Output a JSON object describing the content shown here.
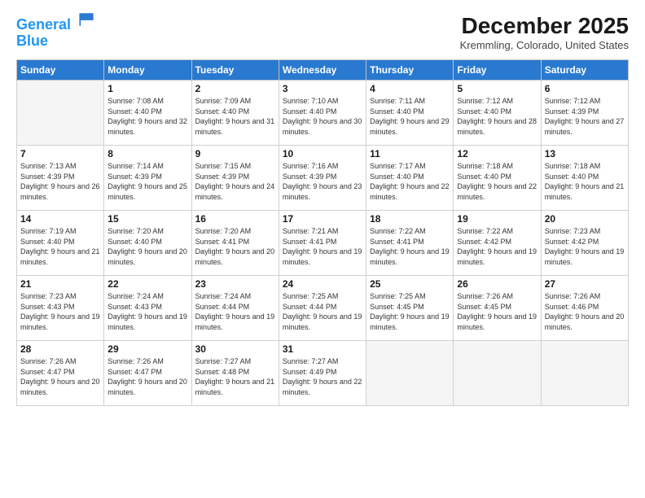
{
  "header": {
    "logo_line1": "General",
    "logo_line2": "Blue",
    "month_title": "December 2025",
    "location": "Kremmling, Colorado, United States"
  },
  "weekdays": [
    "Sunday",
    "Monday",
    "Tuesday",
    "Wednesday",
    "Thursday",
    "Friday",
    "Saturday"
  ],
  "weeks": [
    [
      {
        "day": "",
        "sunrise": "",
        "sunset": "",
        "daylight": ""
      },
      {
        "day": "1",
        "sunrise": "Sunrise: 7:08 AM",
        "sunset": "Sunset: 4:40 PM",
        "daylight": "Daylight: 9 hours and 32 minutes."
      },
      {
        "day": "2",
        "sunrise": "Sunrise: 7:09 AM",
        "sunset": "Sunset: 4:40 PM",
        "daylight": "Daylight: 9 hours and 31 minutes."
      },
      {
        "day": "3",
        "sunrise": "Sunrise: 7:10 AM",
        "sunset": "Sunset: 4:40 PM",
        "daylight": "Daylight: 9 hours and 30 minutes."
      },
      {
        "day": "4",
        "sunrise": "Sunrise: 7:11 AM",
        "sunset": "Sunset: 4:40 PM",
        "daylight": "Daylight: 9 hours and 29 minutes."
      },
      {
        "day": "5",
        "sunrise": "Sunrise: 7:12 AM",
        "sunset": "Sunset: 4:40 PM",
        "daylight": "Daylight: 9 hours and 28 minutes."
      },
      {
        "day": "6",
        "sunrise": "Sunrise: 7:12 AM",
        "sunset": "Sunset: 4:39 PM",
        "daylight": "Daylight: 9 hours and 27 minutes."
      }
    ],
    [
      {
        "day": "7",
        "sunrise": "Sunrise: 7:13 AM",
        "sunset": "Sunset: 4:39 PM",
        "daylight": "Daylight: 9 hours and 26 minutes."
      },
      {
        "day": "8",
        "sunrise": "Sunrise: 7:14 AM",
        "sunset": "Sunset: 4:39 PM",
        "daylight": "Daylight: 9 hours and 25 minutes."
      },
      {
        "day": "9",
        "sunrise": "Sunrise: 7:15 AM",
        "sunset": "Sunset: 4:39 PM",
        "daylight": "Daylight: 9 hours and 24 minutes."
      },
      {
        "day": "10",
        "sunrise": "Sunrise: 7:16 AM",
        "sunset": "Sunset: 4:39 PM",
        "daylight": "Daylight: 9 hours and 23 minutes."
      },
      {
        "day": "11",
        "sunrise": "Sunrise: 7:17 AM",
        "sunset": "Sunset: 4:40 PM",
        "daylight": "Daylight: 9 hours and 22 minutes."
      },
      {
        "day": "12",
        "sunrise": "Sunrise: 7:18 AM",
        "sunset": "Sunset: 4:40 PM",
        "daylight": "Daylight: 9 hours and 22 minutes."
      },
      {
        "day": "13",
        "sunrise": "Sunrise: 7:18 AM",
        "sunset": "Sunset: 4:40 PM",
        "daylight": "Daylight: 9 hours and 21 minutes."
      }
    ],
    [
      {
        "day": "14",
        "sunrise": "Sunrise: 7:19 AM",
        "sunset": "Sunset: 4:40 PM",
        "daylight": "Daylight: 9 hours and 21 minutes."
      },
      {
        "day": "15",
        "sunrise": "Sunrise: 7:20 AM",
        "sunset": "Sunset: 4:40 PM",
        "daylight": "Daylight: 9 hours and 20 minutes."
      },
      {
        "day": "16",
        "sunrise": "Sunrise: 7:20 AM",
        "sunset": "Sunset: 4:41 PM",
        "daylight": "Daylight: 9 hours and 20 minutes."
      },
      {
        "day": "17",
        "sunrise": "Sunrise: 7:21 AM",
        "sunset": "Sunset: 4:41 PM",
        "daylight": "Daylight: 9 hours and 19 minutes."
      },
      {
        "day": "18",
        "sunrise": "Sunrise: 7:22 AM",
        "sunset": "Sunset: 4:41 PM",
        "daylight": "Daylight: 9 hours and 19 minutes."
      },
      {
        "day": "19",
        "sunrise": "Sunrise: 7:22 AM",
        "sunset": "Sunset: 4:42 PM",
        "daylight": "Daylight: 9 hours and 19 minutes."
      },
      {
        "day": "20",
        "sunrise": "Sunrise: 7:23 AM",
        "sunset": "Sunset: 4:42 PM",
        "daylight": "Daylight: 9 hours and 19 minutes."
      }
    ],
    [
      {
        "day": "21",
        "sunrise": "Sunrise: 7:23 AM",
        "sunset": "Sunset: 4:43 PM",
        "daylight": "Daylight: 9 hours and 19 minutes."
      },
      {
        "day": "22",
        "sunrise": "Sunrise: 7:24 AM",
        "sunset": "Sunset: 4:43 PM",
        "daylight": "Daylight: 9 hours and 19 minutes."
      },
      {
        "day": "23",
        "sunrise": "Sunrise: 7:24 AM",
        "sunset": "Sunset: 4:44 PM",
        "daylight": "Daylight: 9 hours and 19 minutes."
      },
      {
        "day": "24",
        "sunrise": "Sunrise: 7:25 AM",
        "sunset": "Sunset: 4:44 PM",
        "daylight": "Daylight: 9 hours and 19 minutes."
      },
      {
        "day": "25",
        "sunrise": "Sunrise: 7:25 AM",
        "sunset": "Sunset: 4:45 PM",
        "daylight": "Daylight: 9 hours and 19 minutes."
      },
      {
        "day": "26",
        "sunrise": "Sunrise: 7:26 AM",
        "sunset": "Sunset: 4:45 PM",
        "daylight": "Daylight: 9 hours and 19 minutes."
      },
      {
        "day": "27",
        "sunrise": "Sunrise: 7:26 AM",
        "sunset": "Sunset: 4:46 PM",
        "daylight": "Daylight: 9 hours and 20 minutes."
      }
    ],
    [
      {
        "day": "28",
        "sunrise": "Sunrise: 7:26 AM",
        "sunset": "Sunset: 4:47 PM",
        "daylight": "Daylight: 9 hours and 20 minutes."
      },
      {
        "day": "29",
        "sunrise": "Sunrise: 7:26 AM",
        "sunset": "Sunset: 4:47 PM",
        "daylight": "Daylight: 9 hours and 20 minutes."
      },
      {
        "day": "30",
        "sunrise": "Sunrise: 7:27 AM",
        "sunset": "Sunset: 4:48 PM",
        "daylight": "Daylight: 9 hours and 21 minutes."
      },
      {
        "day": "31",
        "sunrise": "Sunrise: 7:27 AM",
        "sunset": "Sunset: 4:49 PM",
        "daylight": "Daylight: 9 hours and 22 minutes."
      },
      {
        "day": "",
        "sunrise": "",
        "sunset": "",
        "daylight": ""
      },
      {
        "day": "",
        "sunrise": "",
        "sunset": "",
        "daylight": ""
      },
      {
        "day": "",
        "sunrise": "",
        "sunset": "",
        "daylight": ""
      }
    ]
  ]
}
